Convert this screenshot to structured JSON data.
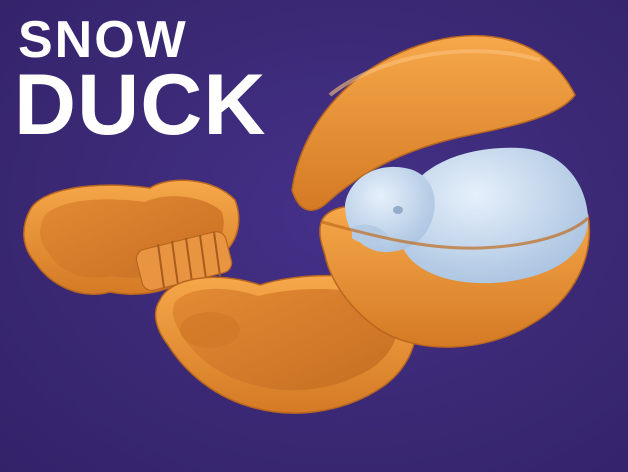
{
  "title": {
    "line1": "SNOW",
    "line2": "DUCK"
  },
  "colors": {
    "background": "#3c2a78",
    "mold_orange": "#e8932f",
    "mold_inner": "#d9832a",
    "snow_white": "#c9dcf0",
    "title_text": "#ffffff"
  },
  "objects": [
    {
      "name": "open-mold",
      "icon": "duck-mold-open"
    },
    {
      "name": "closed-mold-with-snow-duck",
      "icon": "duck-mold-closed"
    }
  ]
}
